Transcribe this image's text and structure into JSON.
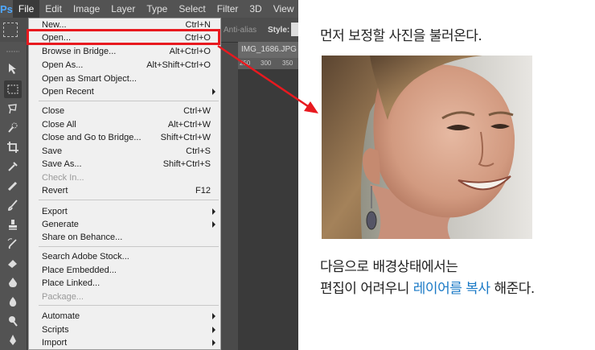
{
  "app": {
    "logo": "Ps"
  },
  "menubar": {
    "items": [
      "File",
      "Edit",
      "Image",
      "Layer",
      "Type",
      "Select",
      "Filter",
      "3D",
      "View"
    ],
    "active": "File"
  },
  "options_bar": {
    "anti_alias": "Anti-alias",
    "style_label": "Style:"
  },
  "document": {
    "tab_title": "IMG_1686.JPG @",
    "ruler_ticks": [
      "250",
      "300",
      "350"
    ]
  },
  "file_menu": {
    "new": {
      "label": "New...",
      "shortcut": "Ctrl+N"
    },
    "open": {
      "label": "Open...",
      "shortcut": "Ctrl+O"
    },
    "browse_in_bridge": {
      "label": "Browse in Bridge...",
      "shortcut": "Alt+Ctrl+O"
    },
    "open_as": {
      "label": "Open As...",
      "shortcut": "Alt+Shift+Ctrl+O"
    },
    "open_as_smart_object": {
      "label": "Open as Smart Object..."
    },
    "open_recent": {
      "label": "Open Recent"
    },
    "close": {
      "label": "Close",
      "shortcut": "Ctrl+W"
    },
    "close_all": {
      "label": "Close All",
      "shortcut": "Alt+Ctrl+W"
    },
    "close_and_go_to_bridge": {
      "label": "Close and Go to Bridge...",
      "shortcut": "Shift+Ctrl+W"
    },
    "save": {
      "label": "Save",
      "shortcut": "Ctrl+S"
    },
    "save_as": {
      "label": "Save As...",
      "shortcut": "Shift+Ctrl+S"
    },
    "check_in": {
      "label": "Check In..."
    },
    "revert": {
      "label": "Revert",
      "shortcut": "F12"
    },
    "export": {
      "label": "Export"
    },
    "generate": {
      "label": "Generate"
    },
    "share_on_behance": {
      "label": "Share on Behance..."
    },
    "search_adobe_stock": {
      "label": "Search Adobe Stock..."
    },
    "place_embedded": {
      "label": "Place Embedded..."
    },
    "place_linked": {
      "label": "Place Linked..."
    },
    "package": {
      "label": "Package..."
    },
    "automate": {
      "label": "Automate"
    },
    "scripts": {
      "label": "Scripts"
    },
    "import": {
      "label": "Import"
    }
  },
  "tutorial": {
    "caption1": "먼저 보정할 사진을 불러온다.",
    "caption2_line1": "다음으로 배경상태에서는",
    "caption2_line2_prefix": "편집이 어려우니 ",
    "caption2_line2_highlight1": "레이어를",
    "caption2_line2_space": " ",
    "caption2_line2_highlight2": "복사",
    "caption2_line2_suffix": " 해준다."
  },
  "colors": {
    "highlight_box": "#e8191f",
    "accent_text": "#1979c6",
    "ps_logo": "#4fa8ff"
  }
}
